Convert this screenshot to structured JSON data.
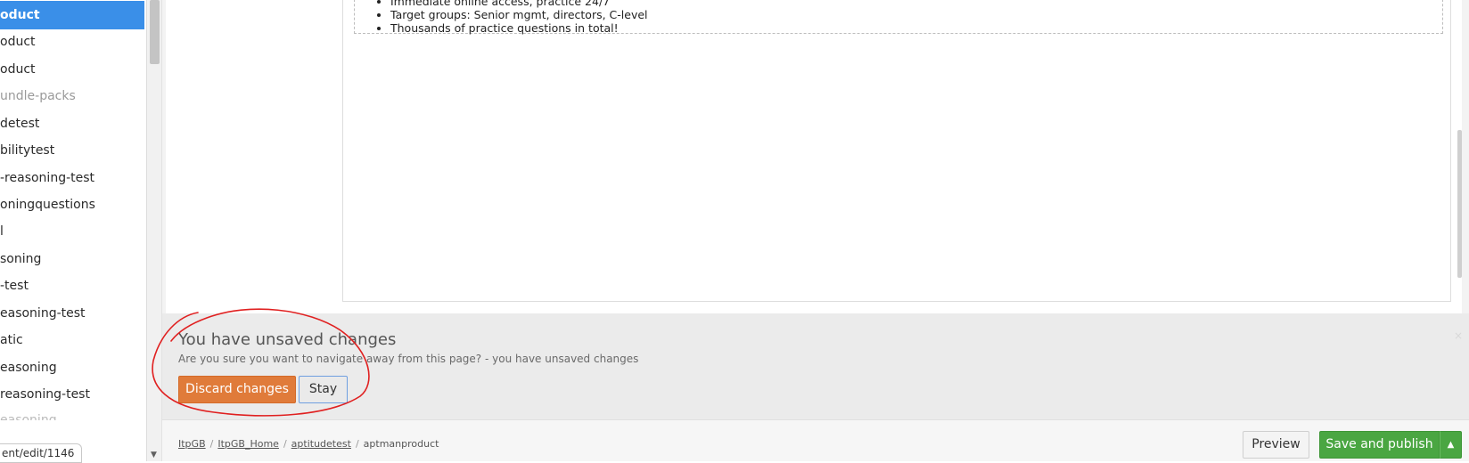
{
  "tree": {
    "items": [
      {
        "label": "oduct",
        "state": "selected"
      },
      {
        "label": "oduct",
        "state": "normal"
      },
      {
        "label": "oduct",
        "state": "normal"
      },
      {
        "label": "undle-packs",
        "state": "muted"
      },
      {
        "label": "detest",
        "state": "normal"
      },
      {
        "label": "bilitytest",
        "state": "normal"
      },
      {
        "label": "-reasoning-test",
        "state": "normal"
      },
      {
        "label": "oningquestions",
        "state": "normal"
      },
      {
        "label": "l",
        "state": "normal"
      },
      {
        "label": "soning",
        "state": "normal"
      },
      {
        "label": "-test",
        "state": "normal"
      },
      {
        "label": "easoning-test",
        "state": "normal"
      },
      {
        "label": "atic",
        "state": "normal"
      },
      {
        "label": "easoning",
        "state": "normal"
      },
      {
        "label": "reasoning-test",
        "state": "normal"
      }
    ],
    "url_tooltip": "ent/edit/1146"
  },
  "editor": {
    "bullets": [
      "Immediate online access, practice 24/7",
      "Target groups: Senior mgmt, directors, C-level",
      "Thousands of practice questions in total!"
    ]
  },
  "unsaved": {
    "title": "You have unsaved changes",
    "message": "Are you sure you want to navigate away from this page? - you have unsaved changes",
    "discard_label": "Discard changes",
    "stay_label": "Stay",
    "close_symbol": "×"
  },
  "footer": {
    "breadcrumb": [
      "ItpGB",
      "ItpGB_Home",
      "aptitudetest"
    ],
    "breadcrumb_current": "aptmanproduct",
    "preview_label": "Preview",
    "save_label": "Save and publish",
    "caret_symbol": "▲"
  },
  "colors": {
    "selected_bg": "#3a8fe8",
    "discard_bg": "#e07b3a",
    "save_bg": "#4aa642",
    "annotation": "#e02020"
  }
}
